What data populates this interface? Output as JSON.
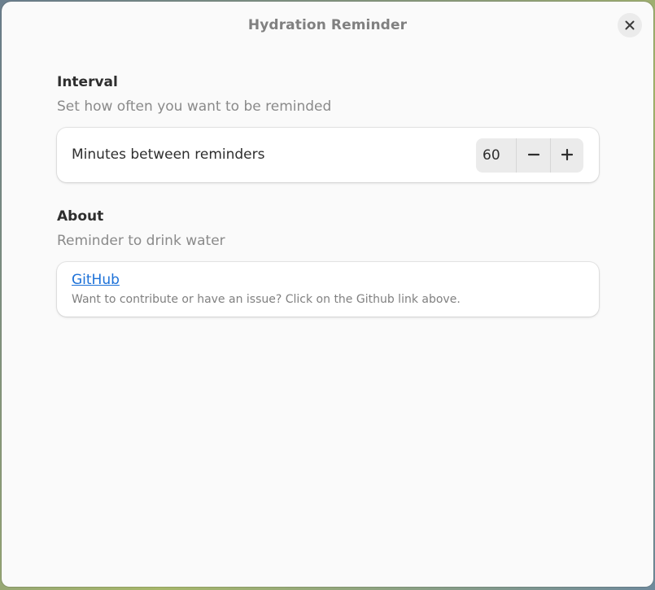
{
  "window": {
    "title": "Hydration Reminder"
  },
  "interval": {
    "title": "Interval",
    "description": "Set how often you want to be reminded",
    "row_label": "Minutes between reminders",
    "value": "60",
    "decrement_symbol": "−",
    "increment_symbol": "+"
  },
  "about": {
    "title": "About",
    "description": "Reminder to drink water",
    "link_label": "GitHub",
    "link_description": "Want to contribute or have an issue? Click on the Github link above."
  },
  "icons": {
    "close": "close-icon",
    "minus": "minus-icon",
    "plus": "plus-icon"
  },
  "colors": {
    "accent_link": "#1c71d8",
    "window_bg": "#fafafa",
    "card_bg": "#ffffff",
    "title_text": "#808080"
  }
}
